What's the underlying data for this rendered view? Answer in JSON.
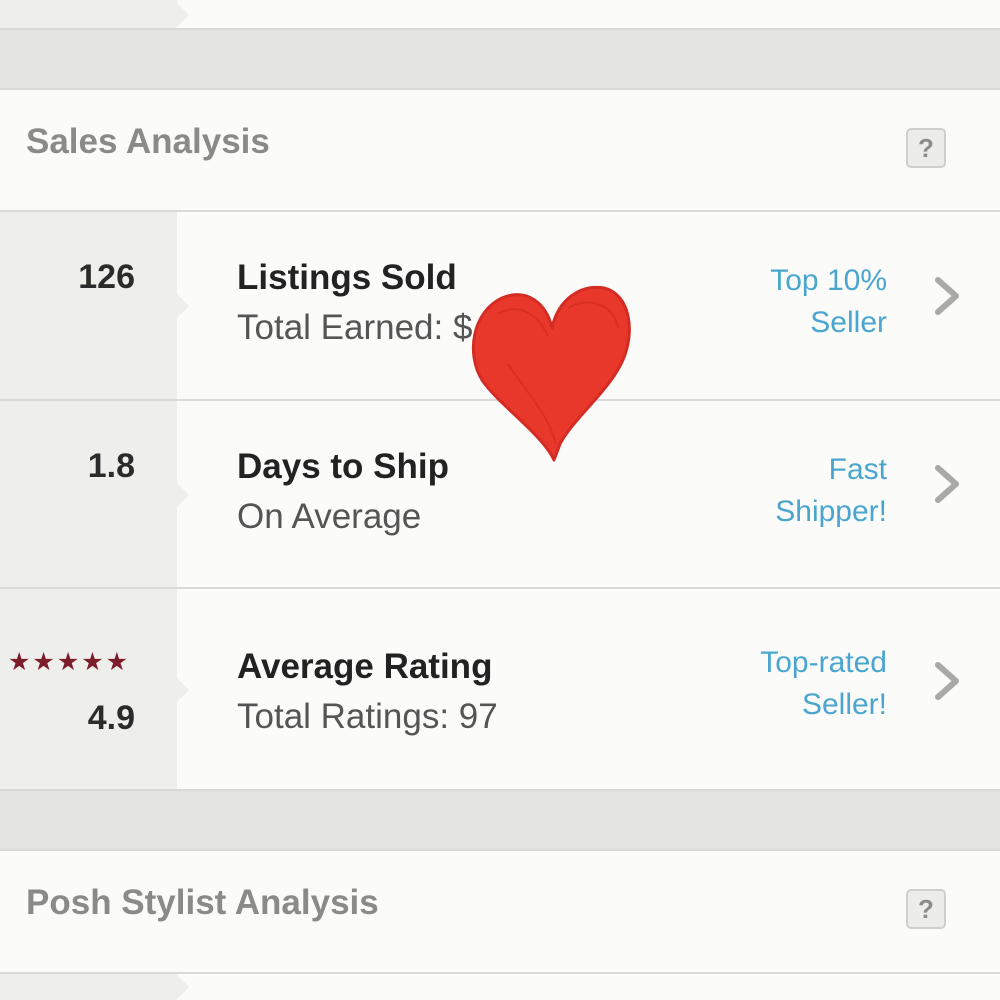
{
  "sales_section": {
    "title": "Sales Analysis",
    "help_label": "?"
  },
  "stats": [
    {
      "value": "126",
      "title": "Listings Sold",
      "subtitle": "Total Earned: $",
      "badge_line1": "Top 10%",
      "badge_line2": "Seller"
    },
    {
      "value": "1.8",
      "title": "Days to Ship",
      "subtitle": "On Average",
      "badge_line1": "Fast",
      "badge_line2": "Shipper!"
    },
    {
      "value": "4.9",
      "stars": "★★★★★",
      "rating_out_of_5": 5,
      "title": "Average Rating",
      "subtitle": "Total Ratings: 97",
      "badge_line1": "Top-rated",
      "badge_line2": "Seller!"
    }
  ],
  "stylist_section": {
    "title": "Posh Stylist Analysis",
    "help_label": "?"
  },
  "colors": {
    "badge": "#4aa6cf",
    "stars": "#7d1c2b",
    "heart": "#e8382c"
  }
}
